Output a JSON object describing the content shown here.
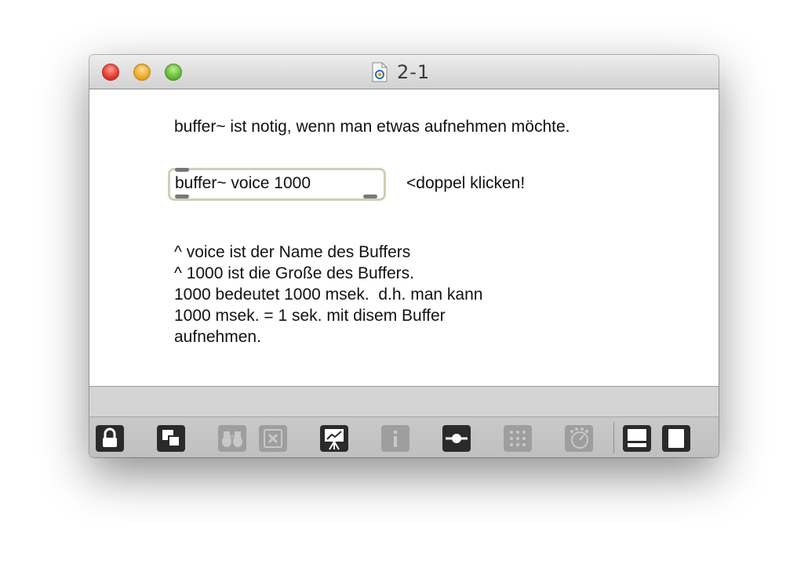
{
  "window": {
    "title": "2-1"
  },
  "canvas": {
    "comment_top": "buffer~ ist notig, wenn man etwas aufnehmen möchte.",
    "message_box": "buffer~ voice 1000",
    "comment_hint": "<doppel klicken!",
    "comment_lines": [
      "^ voice ist der Name des Buffers",
      "^ 1000 ist die Große des Buffers.",
      "1000 bedeutet 1000 msek.  d.h. man kann",
      "1000 msek. = 1 sek. mit disem Buffer",
      "aufnehmen."
    ]
  },
  "toolbar": {
    "buttons": [
      {
        "icon": "lock-icon",
        "enabled": true
      },
      {
        "icon": "presentation-mode-icon",
        "enabled": true
      },
      {
        "icon": "binoculars-icon",
        "enabled": false
      },
      {
        "icon": "clear-icon",
        "enabled": false
      },
      {
        "icon": "easel-icon",
        "enabled": true
      },
      {
        "icon": "info-icon",
        "enabled": false
      },
      {
        "icon": "patch-cord-icon",
        "enabled": true
      },
      {
        "icon": "grid-icon",
        "enabled": false
      },
      {
        "icon": "dial-icon",
        "enabled": false
      },
      {
        "icon": "bottom-panel-icon",
        "enabled": true
      },
      {
        "icon": "right-panel-icon",
        "enabled": true
      }
    ]
  }
}
